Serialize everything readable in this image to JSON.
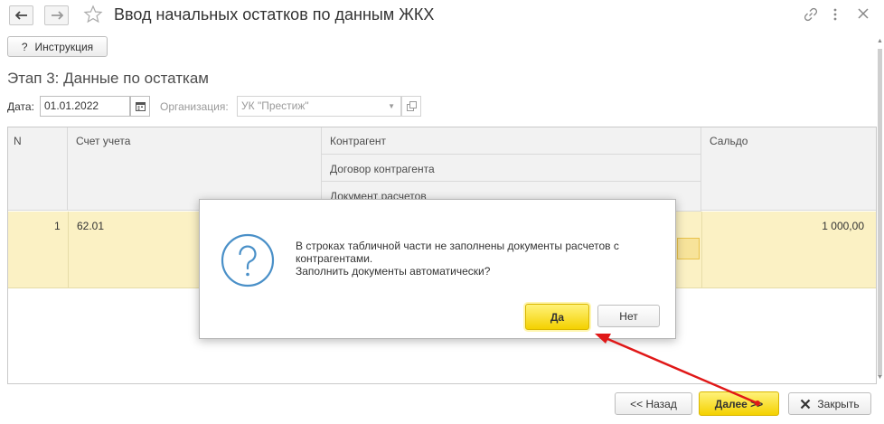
{
  "window": {
    "title": "Ввод начальных остатков по данным ЖКХ"
  },
  "toolbar": {
    "instruction_label": "Инструкция"
  },
  "stage_title": "Этап 3: Данные по остаткам",
  "filters": {
    "date_label": "Дата:",
    "date_value": "01.01.2022",
    "org_label": "Организация:",
    "org_value": "УК \"Престиж\""
  },
  "table": {
    "columns": {
      "n": "N",
      "account": "Счет учета",
      "counterparty": "Контрагент",
      "contract": "Договор контрагента",
      "document": "Документ расчетов",
      "balance": "Сальдо"
    },
    "rows": [
      {
        "n": "1",
        "account": "62.01",
        "balance": "1 000,00"
      }
    ]
  },
  "dialog": {
    "message_line1": "В строках табличной части не заполнены документы расчетов с",
    "message_line2": "контрагентами.",
    "message_line3": "Заполнить документы автоматически?",
    "yes_label": "Да",
    "no_label": "Нет"
  },
  "footer": {
    "back_label": "<< Назад",
    "next_label": "Далее >>",
    "close_label": "Закрыть"
  },
  "colors": {
    "accent_yellow": "#f4d100",
    "row_highlight": "#fbf1c4",
    "annotation_arrow": "#e01818",
    "question_icon": "#4a90c8"
  },
  "icons": [
    "back-arrow-icon",
    "forward-arrow-icon",
    "star-icon",
    "link-icon",
    "more-icon",
    "close-icon",
    "question-icon",
    "calendar-icon",
    "dropdown-icon",
    "open-icon",
    "close-x-icon"
  ]
}
